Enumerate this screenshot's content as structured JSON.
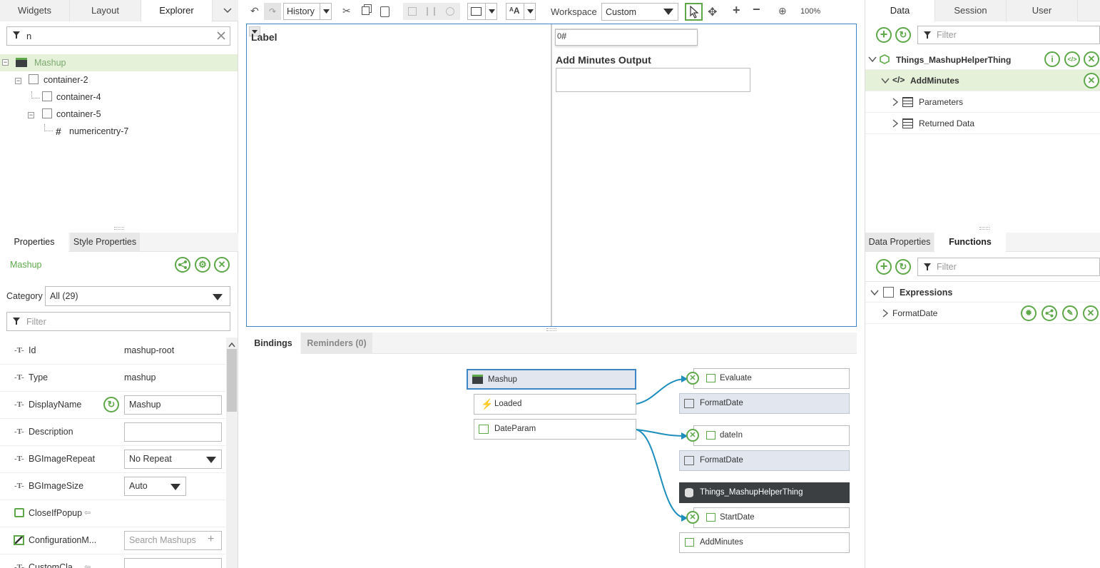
{
  "left_tabs": [
    "Widgets",
    "Layout",
    "Explorer"
  ],
  "explorer": {
    "filter_value": "n",
    "tree": [
      {
        "label": "Mashup",
        "indent": 0
      },
      {
        "label": "container-2",
        "indent": 1
      },
      {
        "label": "container-4",
        "indent": 2
      },
      {
        "label": "container-5",
        "indent": 2
      },
      {
        "label": "numericentry-7",
        "indent": 3
      }
    ]
  },
  "props_tabs": [
    "Properties",
    "Style Properties"
  ],
  "props": {
    "entity": "Mashup",
    "category_label": "Category",
    "category_value": "All (29)",
    "filter_placeholder": "Filter",
    "rows": [
      {
        "name": "Id",
        "value": "mashup-root"
      },
      {
        "name": "Type",
        "value": "mashup"
      },
      {
        "name": "DisplayName",
        "value": "Mashup"
      },
      {
        "name": "Description",
        "value": ""
      },
      {
        "name": "BGImageRepeat",
        "value": "No Repeat"
      },
      {
        "name": "BGImageSize",
        "value": "Auto"
      },
      {
        "name": "CloseIfPopup",
        "value": ""
      },
      {
        "name": "ConfigurationM...",
        "value": "Search Mashups"
      },
      {
        "name": "CustomCla...",
        "value": ""
      }
    ]
  },
  "toolbar": {
    "history_label": "History",
    "workspace_label": "Workspace",
    "workspace_value": "Custom",
    "zoom": "100%"
  },
  "canvas": {
    "label_widget": "Label",
    "numeric_value": "0",
    "output_title": "Add Minutes Output"
  },
  "bottom_tabs": [
    "Bindings",
    "Reminders (0)"
  ],
  "bindings": {
    "source": [
      "Mashup",
      "Loaded",
      "DateParam"
    ],
    "targets": [
      "Evaluate",
      "FormatDate",
      "dateIn",
      "FormatDate",
      "Things_MashupHelperThing",
      "StartDate",
      "AddMinutes"
    ]
  },
  "right_tabs": [
    "Data",
    "Session",
    "User"
  ],
  "data_panel": {
    "filter_placeholder": "Filter",
    "thing": "Things_MashupHelperThing",
    "service": "AddMinutes",
    "children": [
      "Parameters",
      "Returned Data"
    ]
  },
  "right_bottom_tabs": [
    "Data Properties",
    "Functions"
  ],
  "functions_panel": {
    "filter_placeholder": "Filter",
    "group": "Expressions",
    "item": "FormatDate"
  },
  "colors": {
    "accent": "#5ea84a",
    "selection": "#e5f2d9",
    "binding_line": "#1e8fbd",
    "dark_node": "#3b3f42"
  }
}
